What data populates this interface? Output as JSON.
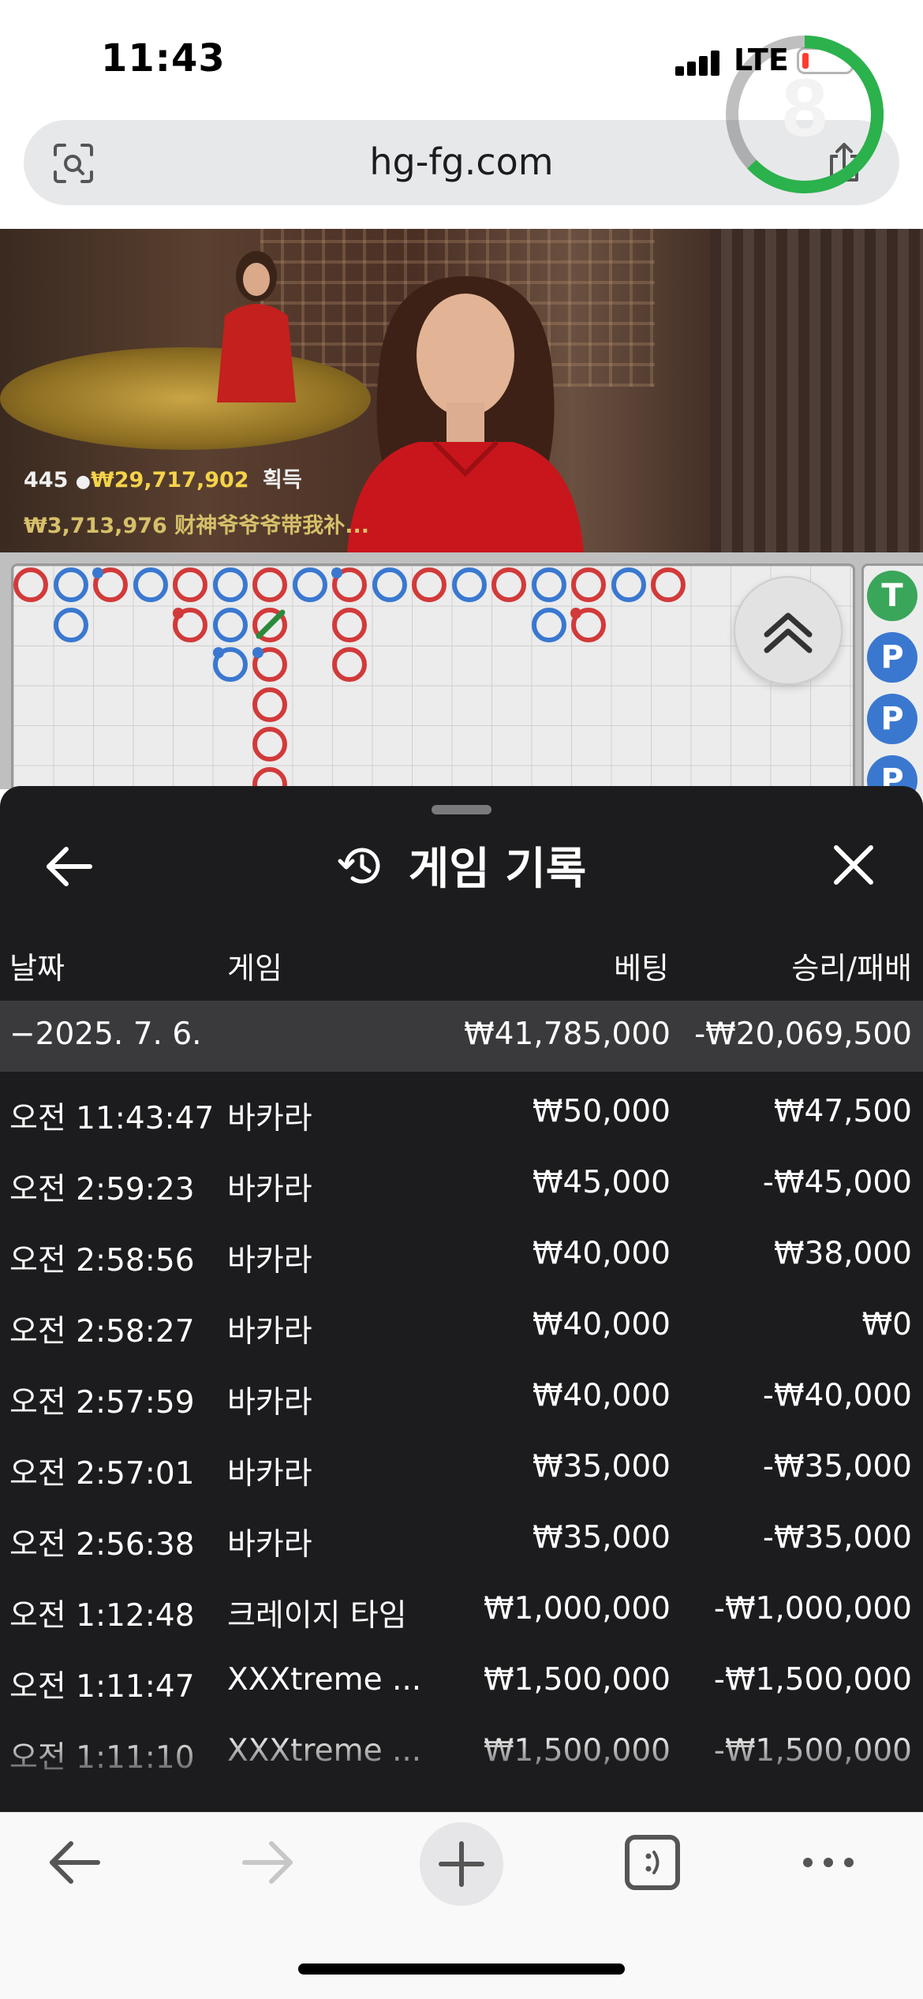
{
  "status_bar": {
    "time": "11:43",
    "network": "LTE"
  },
  "browser": {
    "url": "hg-fg.com"
  },
  "video": {
    "players": "445",
    "total_win": "₩29,717,902",
    "win_label": "획득",
    "ticker": "₩3,713,976 财神爷爷爷带我补...",
    "countdown": "8"
  },
  "bead_road": {
    "side_labels": [
      "T",
      "P",
      "P",
      "P"
    ]
  },
  "history": {
    "title": "게임 기록",
    "columns": {
      "date": "날짜",
      "game": "게임",
      "bet": "베팅",
      "winloss": "승리/패배"
    },
    "date_group": {
      "date": "−2025. 7. 6.",
      "bet": "₩41,785,000",
      "winloss": "-₩20,069,500"
    },
    "rows": [
      {
        "time": "오전 11:43:47",
        "game": "바카라",
        "bet": "₩50,000",
        "winloss": "₩47,500"
      },
      {
        "time": "오전 2:59:23",
        "game": "바카라",
        "bet": "₩45,000",
        "winloss": "-₩45,000"
      },
      {
        "time": "오전 2:58:56",
        "game": "바카라",
        "bet": "₩40,000",
        "winloss": "₩38,000"
      },
      {
        "time": "오전 2:58:27",
        "game": "바카라",
        "bet": "₩40,000",
        "winloss": "₩0"
      },
      {
        "time": "오전 2:57:59",
        "game": "바카라",
        "bet": "₩40,000",
        "winloss": "-₩40,000"
      },
      {
        "time": "오전 2:57:01",
        "game": "바카라",
        "bet": "₩35,000",
        "winloss": "-₩35,000"
      },
      {
        "time": "오전 2:56:38",
        "game": "바카라",
        "bet": "₩35,000",
        "winloss": "-₩35,000"
      },
      {
        "time": "오전 1:12:48",
        "game": "크레이지 타임",
        "bet": "₩1,000,000",
        "winloss": "-₩1,000,000"
      },
      {
        "time": "오전 1:11:47",
        "game": "XXXtreme ...",
        "bet": "₩1,500,000",
        "winloss": "-₩1,500,000"
      },
      {
        "time": "오전 1:11:10",
        "game": "XXXtreme ...",
        "bet": "₩1,500,000",
        "winloss": "-₩1,500,000"
      }
    ]
  },
  "colors": {
    "player_blue": "#3a78d0",
    "banker_red": "#d23a3a",
    "timer_green": "#2bb24c",
    "sheet_bg": "#1c1c1e"
  },
  "icons": [
    "camera-search-icon",
    "share-icon",
    "back-arrow-icon",
    "history-icon",
    "close-icon",
    "chevron-up-icon",
    "forward-arrow-icon",
    "plus-icon",
    "tabs-icon",
    "more-icon"
  ]
}
